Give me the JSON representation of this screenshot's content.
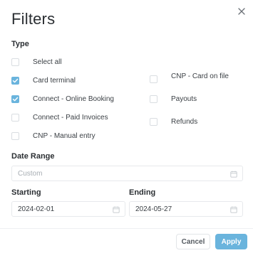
{
  "dialog": {
    "title": "Filters"
  },
  "type_section": {
    "label": "Type",
    "options_left": [
      {
        "label": "Select all",
        "checked": false
      },
      {
        "label": "Card terminal",
        "checked": true
      },
      {
        "label": "Connect - Online Booking",
        "checked": true
      },
      {
        "label": "Connect - Paid Invoices",
        "checked": false
      },
      {
        "label": "CNP - Manual entry",
        "checked": false
      }
    ],
    "options_right": [
      {
        "label": "CNP - Card on file",
        "checked": false
      },
      {
        "label": "Payouts",
        "checked": false
      },
      {
        "label": "Refunds",
        "checked": false
      }
    ]
  },
  "date_range": {
    "label": "Date Range",
    "placeholder": "Custom",
    "starting_label": "Starting",
    "starting_value": "2024-02-01",
    "ending_label": "Ending",
    "ending_value": "2024-05-27"
  },
  "footer": {
    "cancel_label": "Cancel",
    "apply_label": "Apply"
  },
  "colors": {
    "accent": "#6ab4dd",
    "text": "#2b2f33",
    "border": "#e7e9ec"
  }
}
